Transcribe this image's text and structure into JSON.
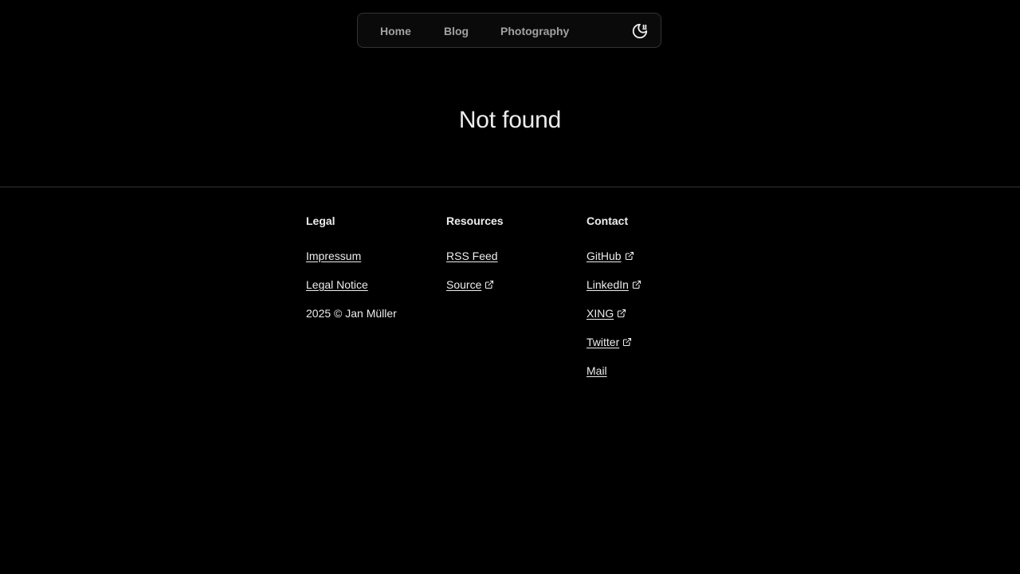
{
  "nav": {
    "items": [
      {
        "label": "Home"
      },
      {
        "label": "Blog"
      },
      {
        "label": "Photography"
      }
    ],
    "theme_icon": "moon-stars-icon"
  },
  "main": {
    "title": "Not found"
  },
  "footer": {
    "legal": {
      "heading": "Legal",
      "links": [
        "Impressum",
        "Legal Notice"
      ],
      "copyright": "2025 © Jan Müller"
    },
    "resources": {
      "heading": "Resources",
      "links": [
        "RSS Feed",
        "Source"
      ]
    },
    "contact": {
      "heading": "Contact",
      "links": [
        "GitHub",
        "LinkedIn",
        "XING",
        "Twitter",
        "Mail"
      ]
    },
    "external_icon": "external-link-icon"
  }
}
